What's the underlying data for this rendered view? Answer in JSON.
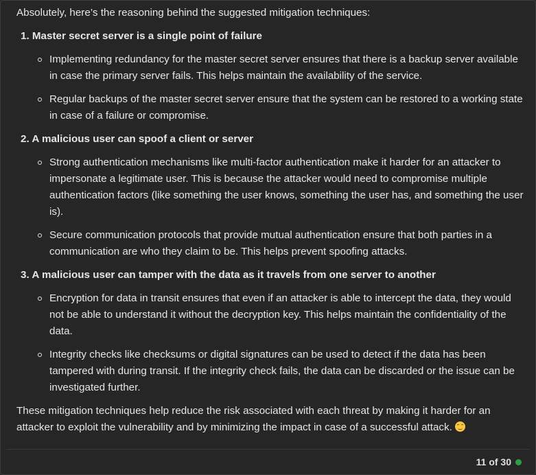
{
  "intro": "Absolutely, here’s the reasoning behind the suggested mitigation techniques:",
  "sections": [
    {
      "number": "1.",
      "title": "Master secret server is a single point of failure",
      "bullets": [
        "Implementing redundancy for the master secret server ensures that there is a backup server available in case the primary server fails. This helps maintain the availability of the service.",
        "Regular backups of the master secret server ensure that the system can be restored to a working state in case of a failure or compromise."
      ]
    },
    {
      "number": "2.",
      "title": "A malicious user can spoof a client or server",
      "bullets": [
        "Strong authentication mechanisms like multi-factor authentication make it harder for an attacker to impersonate a legitimate user. This is because the attacker would need to compromise multiple authentication factors (like something the user knows, something the user has, and something the user is).",
        "Secure communication protocols that provide mutual authentication ensure that both parties in a communication are who they claim to be. This helps prevent spoofing attacks."
      ]
    },
    {
      "number": "3.",
      "title": "A malicious user can tamper with the data as it travels from one server to another",
      "bullets": [
        "Encryption for data in transit ensures that even if an attacker is able to intercept the data, they would not be able to understand it without the decryption key. This helps maintain the confidentiality of the data.",
        "Integrity checks like checksums or digital signatures can be used to detect if the data has been tampered with during transit. If the integrity check fails, the data can be discarded or the issue can be investigated further."
      ]
    }
  ],
  "outro": "These mitigation techniques help reduce the risk associated with each threat by making it harder for an attacker to exploit the vulnerability and by minimizing the impact in case of a successful attack.",
  "emoji_icon": "smiling-face-icon",
  "footer": {
    "page_indicator": "11 of 30",
    "status_color": "#2ea043"
  }
}
